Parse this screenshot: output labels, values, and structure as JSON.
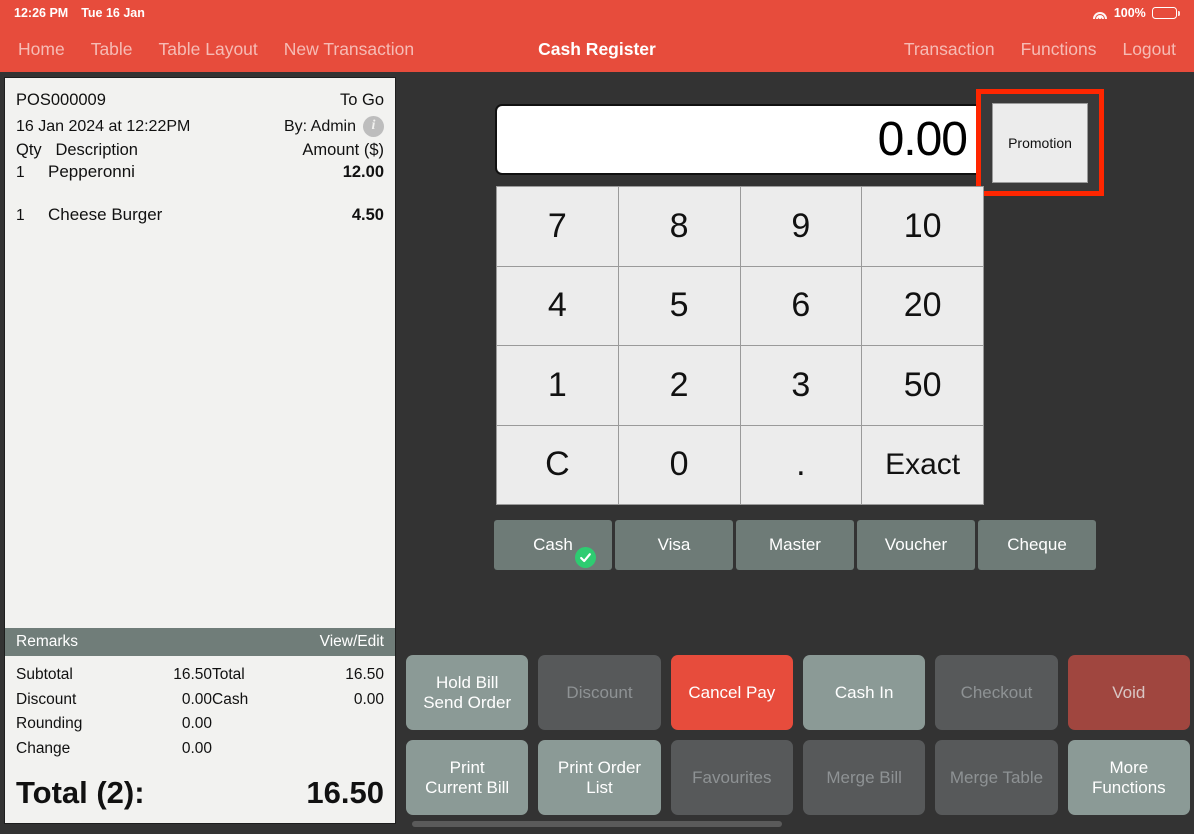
{
  "statusbar": {
    "time": "12:26 PM",
    "date": "Tue 16 Jan",
    "battery_percent": "100%",
    "wifi_icon": "wifi-icon",
    "battery_icon": "battery-icon"
  },
  "navbar": {
    "title": "Cash Register",
    "left_items": [
      {
        "label": "Home"
      },
      {
        "label": "Table"
      },
      {
        "label": "Table Layout"
      },
      {
        "label": "New Transaction"
      }
    ],
    "right_items": [
      {
        "label": "Transaction"
      },
      {
        "label": "Functions"
      },
      {
        "label": "Logout"
      }
    ]
  },
  "receipt": {
    "order_no": "POS000009",
    "order_type": "To Go",
    "datetime": "16 Jan 2024 at 12:22PM",
    "cashier": "By: Admin",
    "info_icon": "info-icon",
    "col_qty": "Qty",
    "col_description": "Description",
    "col_amount": "Amount ($)",
    "items": [
      {
        "qty": "1",
        "description": "Pepperonni",
        "amount": "12.00"
      },
      {
        "qty": "1",
        "description": "Cheese Burger",
        "amount": "4.50"
      }
    ],
    "remarks_label": "Remarks",
    "remarks_action": "View/Edit",
    "totals_left": [
      {
        "label": "Subtotal",
        "value": "16.50"
      },
      {
        "label": "Discount",
        "value": "0.00"
      },
      {
        "label": "Rounding",
        "value": "0.00"
      },
      {
        "label": "Change",
        "value": "0.00"
      }
    ],
    "totals_right": [
      {
        "label": "Total",
        "value": "16.50"
      },
      {
        "label": "Cash",
        "value": "0.00"
      }
    ],
    "grand_label": "Total (2):",
    "grand_value": "16.50"
  },
  "register": {
    "amount_value": "0.00",
    "promotion_label": "Promotion",
    "highlight_color": "#ff2600",
    "keypad": [
      "7",
      "8",
      "9",
      "10",
      "4",
      "5",
      "6",
      "20",
      "1",
      "2",
      "3",
      "50",
      "C",
      "0",
      ".",
      "Exact"
    ],
    "payment_methods": [
      {
        "label": "Cash",
        "selected": true
      },
      {
        "label": "Visa",
        "selected": false
      },
      {
        "label": "Master",
        "selected": false
      },
      {
        "label": "Voucher",
        "selected": false
      },
      {
        "label": "Cheque",
        "selected": false
      }
    ],
    "selected_check_icon": "check-circle-icon",
    "selected_check_color": "#2ecc71",
    "actions": [
      {
        "label": "Hold Bill\nSend Order",
        "state": "enabled"
      },
      {
        "label": "Discount",
        "state": "disabled"
      },
      {
        "label": "Cancel Pay",
        "state": "danger"
      },
      {
        "label": "Cash In",
        "state": "enabled"
      },
      {
        "label": "Checkout",
        "state": "disabled"
      },
      {
        "label": "Void",
        "state": "void"
      },
      {
        "label": "Print\nCurrent Bill",
        "state": "enabled"
      },
      {
        "label": "Print Order\nList",
        "state": "enabled"
      },
      {
        "label": "Favourites",
        "state": "disabled"
      },
      {
        "label": "Merge Bill",
        "state": "disabled"
      },
      {
        "label": "Merge Table",
        "state": "disabled"
      },
      {
        "label": "More\nFunctions",
        "state": "enabled"
      }
    ]
  },
  "colors": {
    "accent_red": "#e74c3c",
    "background_dark": "#333333",
    "receipt_paper": "#f2f2f0",
    "slate": "#707d79"
  }
}
